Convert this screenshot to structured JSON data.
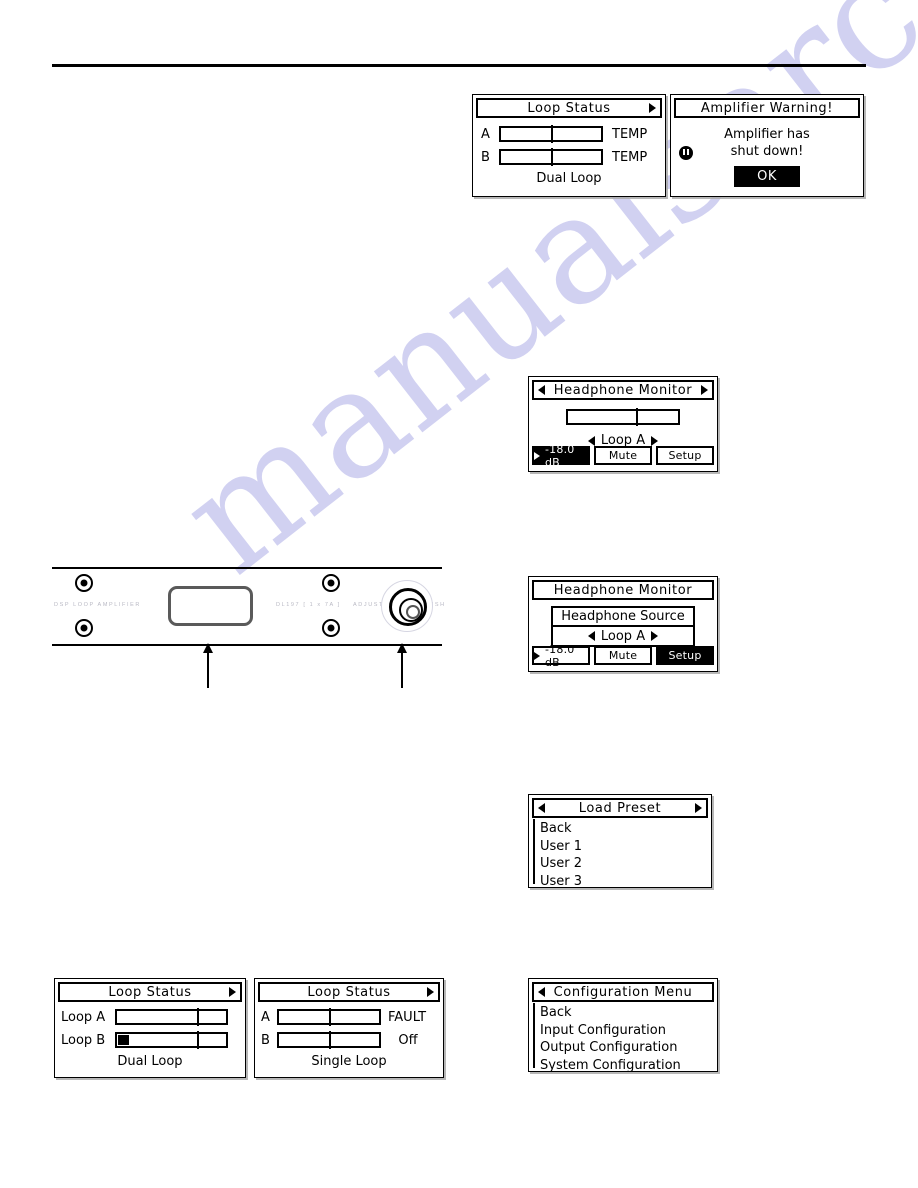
{
  "watermark": {
    "text": "manualsarchive.com"
  },
  "loop_status_top": {
    "title": "Loop Status",
    "has_left_arrow": false,
    "has_right_arrow": true,
    "rows": [
      {
        "label": "A",
        "status": "TEMP",
        "fill_pct": 0
      },
      {
        "label": "B",
        "status": "TEMP",
        "fill_pct": 0
      }
    ],
    "footer": "Dual Loop"
  },
  "amplifier_warning": {
    "title": "Amplifier Warning!",
    "icon": "warning-exclamation-icon",
    "message_line1": "Amplifier has",
    "message_line2": "shut down!",
    "ok_label": "OK"
  },
  "headphone_monitor_1": {
    "title": "Headphone Monitor",
    "has_left_arrow": true,
    "has_right_arrow": true,
    "slider_value_pct": 62,
    "source_label": "Loop A",
    "buttons": [
      {
        "label": "-18.0 dB",
        "icon": "speaker-icon",
        "selected": true
      },
      {
        "label": "Mute",
        "selected": false
      },
      {
        "label": "Setup",
        "selected": false
      }
    ]
  },
  "headphone_monitor_2": {
    "title": "Headphone Monitor",
    "has_left_arrow": false,
    "has_right_arrow": false,
    "sub_title": "Headphone Source",
    "source_label": "Loop A",
    "buttons": [
      {
        "label": "-18.0 dB",
        "icon": "speaker-icon",
        "selected": false
      },
      {
        "label": "Mute",
        "selected": false
      },
      {
        "label": "Setup",
        "selected": true
      }
    ]
  },
  "load_preset": {
    "title": "Load Preset",
    "has_left_arrow": true,
    "has_right_arrow": true,
    "items": [
      "Back",
      "User 1",
      "User 2",
      "User 3"
    ]
  },
  "configuration_menu": {
    "title": "Configuration Menu",
    "has_left_arrow": true,
    "has_right_arrow": false,
    "items": [
      "Back",
      "Input Configuration",
      "Output Configuration",
      "System Configuration"
    ]
  },
  "loop_status_dual": {
    "title": "Loop Status",
    "has_left_arrow": false,
    "has_right_arrow": true,
    "rows": [
      {
        "label": "Loop A",
        "status": "",
        "fill_pct": 0
      },
      {
        "label": "Loop B",
        "status": "",
        "fill_pct": 11
      }
    ],
    "footer": "Dual Loop"
  },
  "loop_status_single": {
    "title": "Loop Status",
    "has_left_arrow": false,
    "has_right_arrow": true,
    "rows": [
      {
        "label": "A",
        "status": "FAULT",
        "fill_pct": 0
      },
      {
        "label": "B",
        "status": "Off",
        "fill_pct": 0
      }
    ],
    "footer": "Single Loop"
  },
  "front_panel": {
    "brand_label": "DSP LOOP AMPLIFIER",
    "model_label": "DL197 [ 1 x 7A ]",
    "adjust_label": "ADJUST",
    "push_label": "PUSH"
  }
}
